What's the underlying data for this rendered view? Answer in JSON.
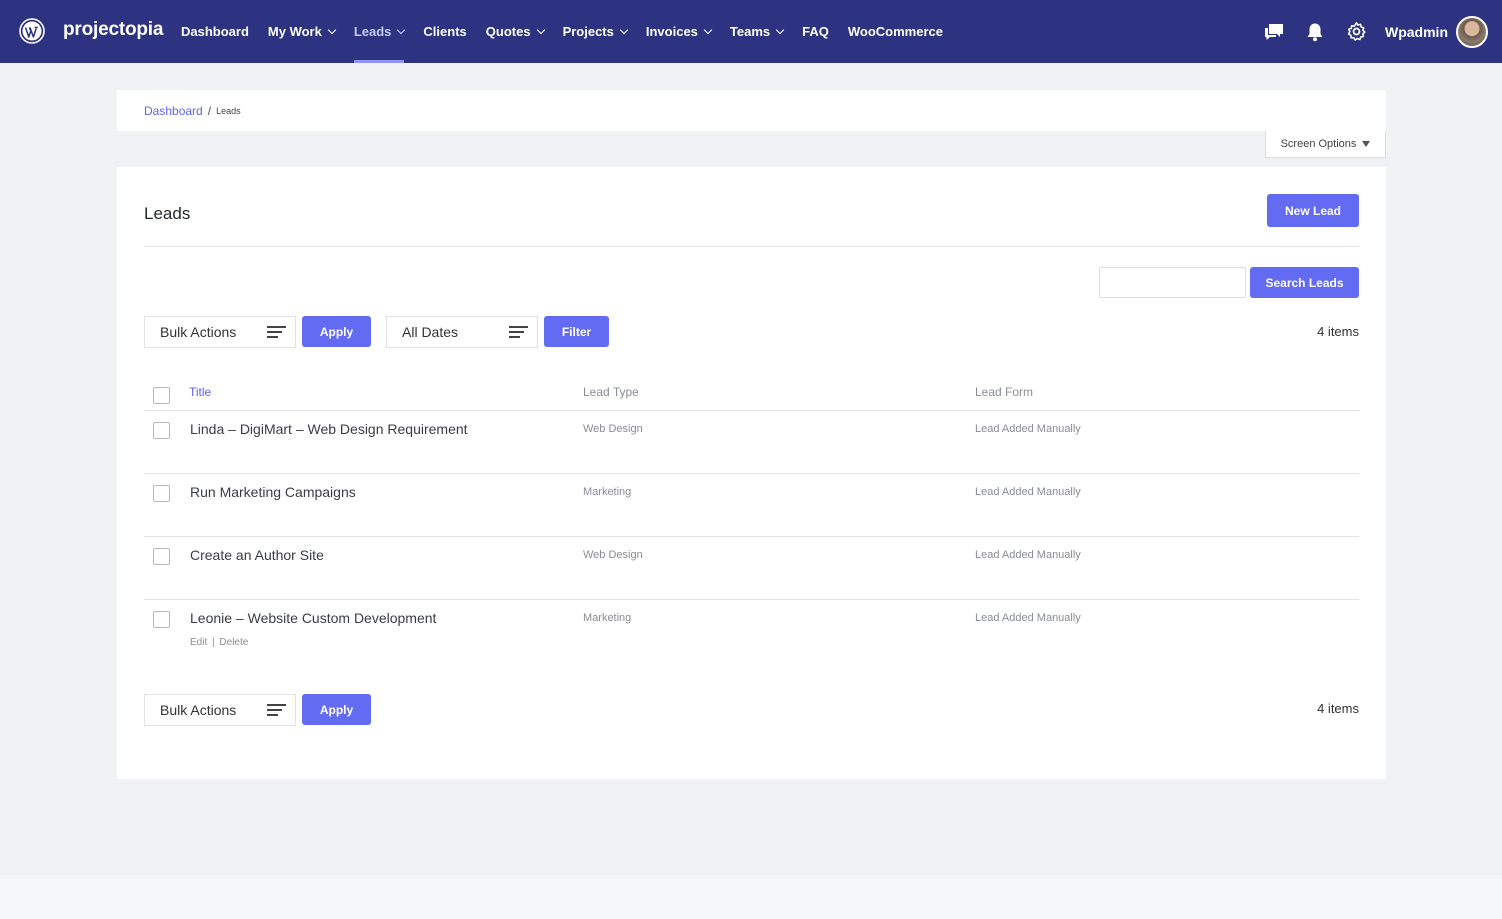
{
  "brand": "projectopia",
  "nav": [
    {
      "label": "Dashboard",
      "has_dropdown": false,
      "active": false
    },
    {
      "label": "My Work",
      "has_dropdown": true,
      "active": false
    },
    {
      "label": "Leads",
      "has_dropdown": true,
      "active": true
    },
    {
      "label": "Clients",
      "has_dropdown": false,
      "active": false
    },
    {
      "label": "Quotes",
      "has_dropdown": true,
      "active": false
    },
    {
      "label": "Projects",
      "has_dropdown": true,
      "active": false
    },
    {
      "label": "Invoices",
      "has_dropdown": true,
      "active": false
    },
    {
      "label": "Teams",
      "has_dropdown": true,
      "active": false
    },
    {
      "label": "FAQ",
      "has_dropdown": false,
      "active": false
    },
    {
      "label": "WooCommerce",
      "has_dropdown": false,
      "active": false
    }
  ],
  "user": {
    "name": "Wpadmin"
  },
  "top_icons": [
    "chat-icon",
    "bell-icon",
    "gear-icon"
  ],
  "breadcrumb": {
    "root": "Dashboard",
    "current": "Leads"
  },
  "screen_options": "Screen Options",
  "page": {
    "title": "Leads",
    "new_button": "New Lead"
  },
  "search": {
    "value": "",
    "button": "Search Leads"
  },
  "filters": {
    "bulk_actions": "Bulk Actions",
    "apply": "Apply",
    "dates": "All Dates",
    "filter": "Filter",
    "items_count": "4 items"
  },
  "table": {
    "columns": [
      "Title",
      "Lead Type",
      "Lead Form"
    ],
    "rows": [
      {
        "title": "Linda – DigiMart – Web Design Requirement",
        "type": "Web Design",
        "form": "Lead Added Manually"
      },
      {
        "title": "Run Marketing Campaigns",
        "type": "Marketing",
        "form": "Lead Added Manually"
      },
      {
        "title": "Create an Author Site",
        "type": "Web Design",
        "form": "Lead Added Manually"
      },
      {
        "title": "Leonie – Website Custom Development",
        "type": "Marketing",
        "form": "Lead Added Manually",
        "actions": {
          "edit": "Edit",
          "sep": "|",
          "delete": "Delete"
        }
      }
    ]
  },
  "colors": {
    "topbar": "#2d3281",
    "accent": "#636bf2",
    "link": "#5c64f4"
  }
}
